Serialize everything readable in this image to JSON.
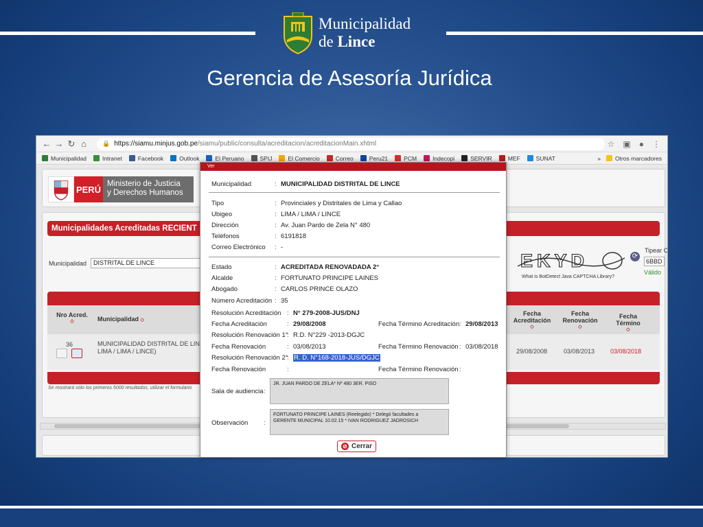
{
  "logo": {
    "line1": "Municipalidad",
    "line2_prefix": "de ",
    "line2_bold": "Lince"
  },
  "slide_title": "Gerencia de Asesoría Jurídica",
  "browser": {
    "url_host": "https://siamu.minjus.gob.pe",
    "url_path": "/siamu/public/consulta/acreditacion/acreditacionMain.xhtml",
    "bookmarks": [
      "Municipalidad",
      "Intranet",
      "Facebook",
      "Outlook",
      "El Peruano",
      "SPIJ",
      "El Comercio",
      "Correo",
      "Peru21",
      "PCM",
      "Indecopi",
      "SERVIR",
      "MEF",
      "SUNAT"
    ],
    "bookmark_colors": [
      "#2e7d32",
      "#388e3c",
      "#3b5998",
      "#0072c6",
      "#1565c0",
      "#555555",
      "#f2a900",
      "#c62828",
      "#0d47a1",
      "#d32f2f",
      "#c2185b",
      "#222222",
      "#b71c1c",
      "#1e88e5"
    ],
    "more_label": "»",
    "other_bookmarks": "Otros marcadores"
  },
  "site": {
    "peru": "PERÚ",
    "ministry_line1": "Ministerio de Justicia",
    "ministry_line2": "y Derechos Humanos",
    "section_title": "Municipalidades Acreditadas RECIENT",
    "filter_label": "Municipalidad",
    "filter_value": "DISTRITAL DE LINCE",
    "captcha_caption": "What is BotDetect Java CAPTCHA Library?",
    "captcha_text": "EKYD",
    "tipear_label": "Tipear Ca",
    "tipear_value": "6BBD",
    "valido": "Válido",
    "table": {
      "headers": {
        "nro": "Nro Acred.",
        "municipalidad": "Municipalidad",
        "fecha_acred_1": "Fecha",
        "fecha_acred_2": "Acreditación",
        "fecha_renov_1": "Fecha",
        "fecha_renov_2": "Renovación",
        "fecha_term_1": "Fecha",
        "fecha_term_2": "Término"
      },
      "row": {
        "nro": "36",
        "municipalidad_1": "MUNICIPALIDAD DISTRITAL DE LIN",
        "municipalidad_2": "LIMA / LIMA / LINCE)",
        "fecha_acred": "29/08/2008",
        "fecha_renov": "03/08/2013",
        "fecha_term": "03/08/2018"
      }
    },
    "foot_note": "Se mostrará sólo los primeros 5000 resultados, utilizar el formulario"
  },
  "modal": {
    "top_label": "Ver",
    "municipalidad_label": "Municipalidad",
    "municipalidad_value": "MUNICIPALIDAD DISTRITAL DE LINCE",
    "tipo_label": "Tipo",
    "tipo_value": "Provinciales y Distritales de Lima y Callao",
    "ubigeo_label": "Ubigeo",
    "ubigeo_value": "LIMA / LIMA / LINCE",
    "direccion_label": "Dirección",
    "direccion_value": "Av. Juan Pardo de Zela N° 480",
    "telefonos_label": "Teléfonos",
    "telefonos_value": "6191818",
    "correo_label": "Correo Electrónico",
    "correo_value": "-",
    "estado_label": "Estado",
    "estado_value": "ACREDITADA RENOVADADA 2°",
    "alcalde_label": "Alcalde",
    "alcalde_value": "FORTUNATO PRINCIPE LAINES",
    "abogado_label": "Abogado",
    "abogado_value": "CARLOS PRINCE OLAZO",
    "nro_acred_label": "Número Acreditación",
    "nro_acred_value": "35",
    "res_acred_label": "Resolución Acreditación",
    "res_acred_value": "N° 279-2008-JUS/DNJ",
    "fecha_acred_label": "Fecha Acreditación",
    "fecha_acred_value": "29/08/2008",
    "fecha_term_acred_label": "Fecha Término Acreditación",
    "fecha_term_acred_value": "29/08/2013",
    "res_renov1_label": "Resolución Renovación 1°",
    "res_renov1_value": "R.D. N°229 -2013-DGJC",
    "fecha_renov1_label": "Fecha Renovación",
    "fecha_renov1_value": "03/08/2013",
    "fecha_term_renov1_label": "Fecha Término Renovación",
    "fecha_term_renov1_value": "03/08/2018",
    "res_renov2_label": "Resolución Renovación 2°",
    "res_renov2_value": "R. D. N°168-2018-JUS/DGJC",
    "fecha_renov2_label": "Fecha Renovación",
    "fecha_renov2_value": "",
    "fecha_term_renov2_label": "Fecha Término Renovación",
    "fecha_term_renov2_value": "",
    "sala_label": "Sala de audiencia",
    "sala_value": "JR. JUAN PARDO DE ZELA* Nº 480 3ER. PISO",
    "obs_label": "Observación",
    "obs_value_1": "FORTUNATO PRINCIPE LAINES (Reelegido) * Delegó facultades a",
    "obs_value_2": "GERENTE MUNICIPAL 10.02.15 * IVAN RODRIGUEZ JADROSICH",
    "sep": ":",
    "close_label": "Cerrar"
  }
}
